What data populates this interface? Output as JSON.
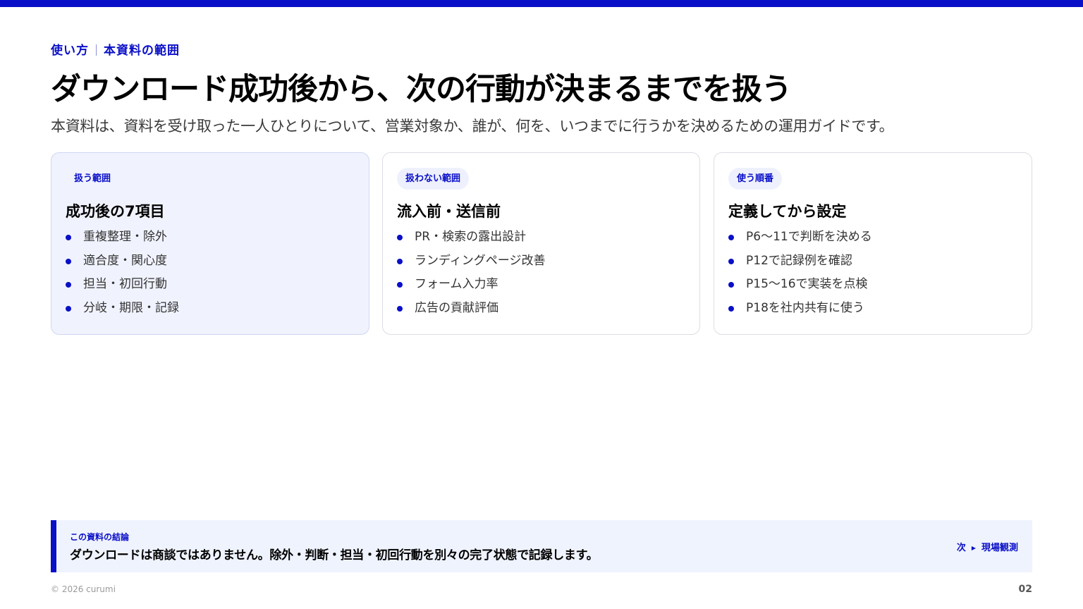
{
  "header": {
    "eyebrow_left": "使い方",
    "eyebrow_right": "本資料の範囲",
    "title": "ダウンロード成功後から、次の行動が決まるまでを扱う",
    "subtitle": "本資料は、資料を受け取った一人ひとりについて、営業対象か、誰が、何を、いつまでに行うかを決めるための運用ガイドです。"
  },
  "cards": [
    {
      "badge": "扱う範囲",
      "title": "成功後の7項目",
      "items": [
        "重複整理・除外",
        "適合度・関心度",
        "担当・初回行動",
        "分岐・期限・記録"
      ]
    },
    {
      "badge": "扱わない範囲",
      "title": "流入前・送信前",
      "items": [
        "PR・検索の露出設計",
        "ランディングページ改善",
        "フォーム入力率",
        "広告の貢献評価"
      ]
    },
    {
      "badge": "使う順番",
      "title": "定義してから設定",
      "items": [
        "P6〜11で判断を決める",
        "P12で記録例を確認",
        "P15〜16で実装を点検",
        "P18を社内共有に使う"
      ]
    }
  ],
  "conclusion": {
    "label": "この資料の結論",
    "text": "ダウンロードは商談ではありません。除外・判断・担当・初回行動を別々の完了状態で記録します。",
    "next_label": "次",
    "next_target": "現場観測"
  },
  "footer": {
    "copyright": "© 2026 curumi",
    "page_number": "02"
  },
  "colors": {
    "accent": "#0a0fc8",
    "card_highlight_bg": "#f0f3fe",
    "conclusion_bg": "#eff3fd"
  }
}
